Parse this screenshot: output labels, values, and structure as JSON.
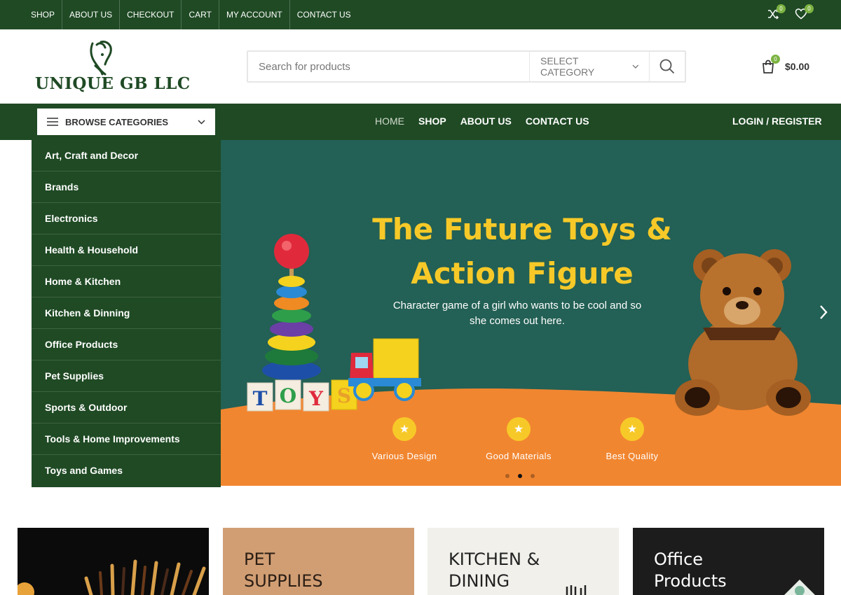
{
  "top_nav": [
    "SHOP",
    "ABOUT US",
    "CHECKOUT",
    "CART",
    "MY ACCOUNT",
    "CONTACT US"
  ],
  "top_icons": {
    "compare": {
      "icon": "compare-icon",
      "count": "0"
    },
    "wishlist": {
      "icon": "heart-icon",
      "count": "0"
    }
  },
  "logo": {
    "text": "UNIQUE GB LLC",
    "color": "#1f4a24"
  },
  "search": {
    "placeholder": "Search for products",
    "category_label": "SELECT CATEGORY"
  },
  "cart": {
    "count": "0",
    "total": "$0.00"
  },
  "main_nav": {
    "browse_label": "BROWSE CATEGORIES",
    "links": [
      "HOME",
      "SHOP",
      "ABOUT US",
      "CONTACT US"
    ],
    "active": "HOME",
    "login_label": "LOGIN / REGISTER"
  },
  "categories": [
    "Art, Craft and Decor",
    "Brands",
    "Electronics",
    "Health & Household",
    "Home & Kitchen",
    "Kitchen & Dinning",
    "Office Products",
    "Pet Supplies",
    "Sports & Outdoor",
    "Tools & Home Improvements",
    "Toys and Games"
  ],
  "hero": {
    "title": "The Future Toys & Action Figure",
    "subtitle": "Character game of a girl who wants to be cool and so she comes out here.",
    "features": [
      "Various Design",
      "Good Materials",
      "Best Quality"
    ],
    "slide_count": 3,
    "active_slide": 2
  },
  "category_tiles": [
    {
      "title": ""
    },
    {
      "title": "PET\nSUPPLIES"
    },
    {
      "title": "KITCHEN &\nDINING"
    },
    {
      "title": "Office\nProducts"
    }
  ],
  "colors": {
    "primary_green": "#1f4a24",
    "hero_teal": "#236055",
    "hero_orange": "#f18630",
    "accent_yellow": "#f7c928",
    "badge_green": "#7cb342"
  }
}
